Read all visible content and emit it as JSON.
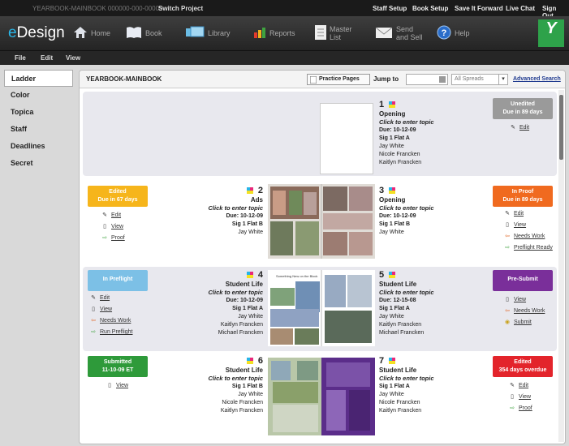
{
  "top": {
    "project": "YEARBOOK-MAINBOOK 000000-000-00000",
    "switch": "Switch Project",
    "links": [
      "Staff Setup",
      "Book Setup",
      "Save It Forward",
      "Live Chat",
      "Sign Out"
    ]
  },
  "nav": {
    "logo_e": "e",
    "logo_rest": "Design",
    "items": [
      "Home",
      "Book",
      "Library",
      "Reports",
      "Master List",
      "Send and Sell",
      "Help"
    ]
  },
  "menu": [
    "File",
    "Edit",
    "View"
  ],
  "sidebar": [
    "Ladder",
    "Color",
    "Topica",
    "Staff",
    "Deadlines",
    "Secret"
  ],
  "header": {
    "title": "YEARBOOK-MAINBOOK",
    "practice": "Practice Pages",
    "jump": "Jump to",
    "spreads": "All Spreads",
    "advanced": "Advanced Search"
  },
  "pages": {
    "p1": {
      "num": "1",
      "section": "Opening",
      "topic": "Click to enter topic",
      "due": "Due: 10-12-09",
      "sig": "Sig 1 Flat A",
      "staff": [
        "Jay White",
        "Nicole Francken",
        "Kaitlyn Francken"
      ]
    },
    "p2": {
      "num": "2",
      "section": "Ads",
      "topic": "Click to enter topic",
      "due": "Due: 10-12-09",
      "sig": "Sig 1 Flat B",
      "staff": [
        "Jay White"
      ]
    },
    "p3": {
      "num": "3",
      "section": "Opening",
      "topic": "Click to enter topic",
      "due": "Due: 10-12-09",
      "sig": "Sig 1 Flat B",
      "staff": [
        "Jay White"
      ]
    },
    "p4": {
      "num": "4",
      "section": "Student Life",
      "topic": "Click to enter topic",
      "due": "Due: 10-12-09",
      "sig": "Sig 1 Flat A",
      "staff": [
        "Jay White",
        "Kaitlyn Francken",
        "Michael Francken"
      ]
    },
    "p5": {
      "num": "5",
      "section": "Student Life",
      "topic": "Click to enter topic",
      "due": "Due: 12-15-08",
      "sig": "Sig 1 Flat A",
      "staff": [
        "Jay White",
        "Kaitlyn Francken",
        "Michael Francken"
      ]
    },
    "p6": {
      "num": "6",
      "section": "Student Life",
      "topic": "Click to enter topic",
      "sig": "Sig 1 Flat B",
      "staff": [
        "Jay White",
        "Nicole Francken",
        "Kaitlyn Francken"
      ]
    },
    "p7": {
      "num": "7",
      "section": "Student Life",
      "topic": "Click to enter topic",
      "sig": "Sig 1 Flat A",
      "staff": [
        "Jay White",
        "Nicole Francken",
        "Kaitlyn Francken"
      ]
    }
  },
  "status": {
    "s1": {
      "title": "Unedited",
      "sub": "Due in 89 days",
      "color": "#9a9a9a"
    },
    "s2": {
      "title": "Edited",
      "sub": "Due in 67 days",
      "color": "#f6b51b"
    },
    "s3": {
      "title": "In Proof",
      "sub": "Due in 89 days",
      "color": "#f06a1f"
    },
    "s4": {
      "title": "In Preflight",
      "color": "#7cc0e6"
    },
    "s5": {
      "title": "Pre-Submit",
      "color": "#7a2f9a"
    },
    "s6": {
      "title": "Submitted",
      "sub": "11-10-09 ET",
      "color": "#2e9a3a"
    },
    "s7": {
      "title": "Edited",
      "sub": "354 days overdue",
      "color": "#e3242b"
    }
  },
  "actions": {
    "edit": "Edit",
    "view": "View",
    "proof": "Proof",
    "needs_work": "Needs Work",
    "preflight_ready": "Preflight Ready",
    "run_preflight": "Run Preflight",
    "submit": "Submit"
  },
  "thumb_text": {
    "t4": "Something New on the Block"
  },
  "colors": {
    "row_alt": "#e8e8ee",
    "row": "#ffffff",
    "link": "#1f3a8f"
  }
}
